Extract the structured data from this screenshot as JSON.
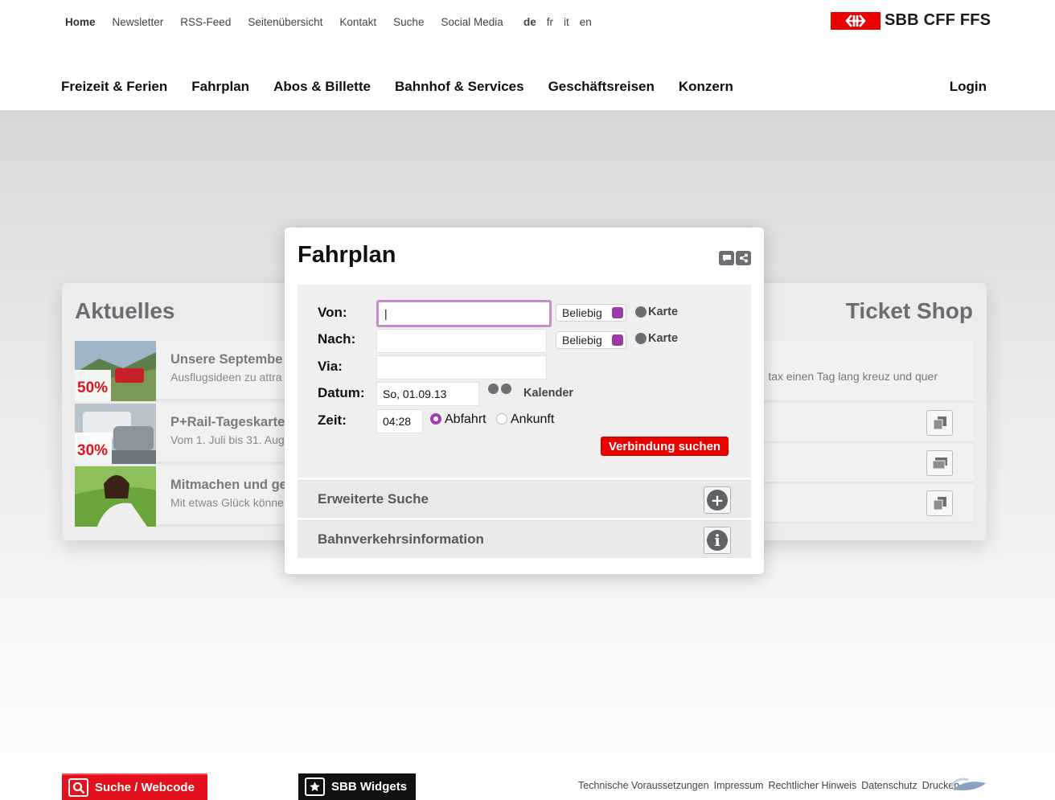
{
  "topnav": {
    "items": [
      "Home",
      "Newsletter",
      "RSS-Feed",
      "Seitenübersicht",
      "Kontakt",
      "Suche",
      "Social Media"
    ],
    "languages": [
      "de",
      "fr",
      "it",
      "en"
    ]
  },
  "logo": {
    "text": "SBB CFF FFS",
    "color": "#eb0000"
  },
  "mainnav": {
    "items": [
      "Freizeit & Ferien",
      "Fahrplan",
      "Abos & Billette",
      "Bahnhof & Services",
      "Geschäftsreisen",
      "Konzern"
    ],
    "login": "Login"
  },
  "aktuelles": {
    "title": "Aktuelles",
    "items": [
      {
        "title": "Unsere Septembe",
        "sub": "Ausflugsideen zu attra",
        "badge": "50%"
      },
      {
        "title": "P+Rail-Tageskarte",
        "sub": "Vom 1. Juli bis 31. Aug",
        "badge": "30%"
      },
      {
        "title": "Mitmachen und ge",
        "sub": "Mit etwas Glück könne"
      }
    ]
  },
  "ticketshop": {
    "title": "Ticket Shop",
    "text": "tax einen Tag lang kreuz und quer"
  },
  "fahrplan": {
    "title": "Fahrplan",
    "labels": {
      "von": "Von:",
      "nach": "Nach:",
      "via": "Via:",
      "datum": "Datum:",
      "zeit": "Zeit:"
    },
    "von_value": "|",
    "nach_value": "",
    "via_value": "",
    "select_value": "Beliebig",
    "karte": "Karte",
    "datum_value": "So, 01.09.13",
    "kalender": "Kalender",
    "zeit_value": "04:28",
    "abfahrt": "Abfahrt",
    "ankunft": "Ankunft",
    "search_button": "Verbindung suchen",
    "accent": "#a23fae"
  },
  "accordion": {
    "erweitert": "Erweiterte Suche",
    "info": "Bahnverkehrsinformation"
  },
  "footer": {
    "search": "Suche / Webcode",
    "widgets": "SBB Widgets",
    "links": [
      "Technische Voraussetzungen",
      "Impressum",
      "Rechtlicher Hinweis",
      "Datenschutz",
      "Drucken"
    ]
  }
}
